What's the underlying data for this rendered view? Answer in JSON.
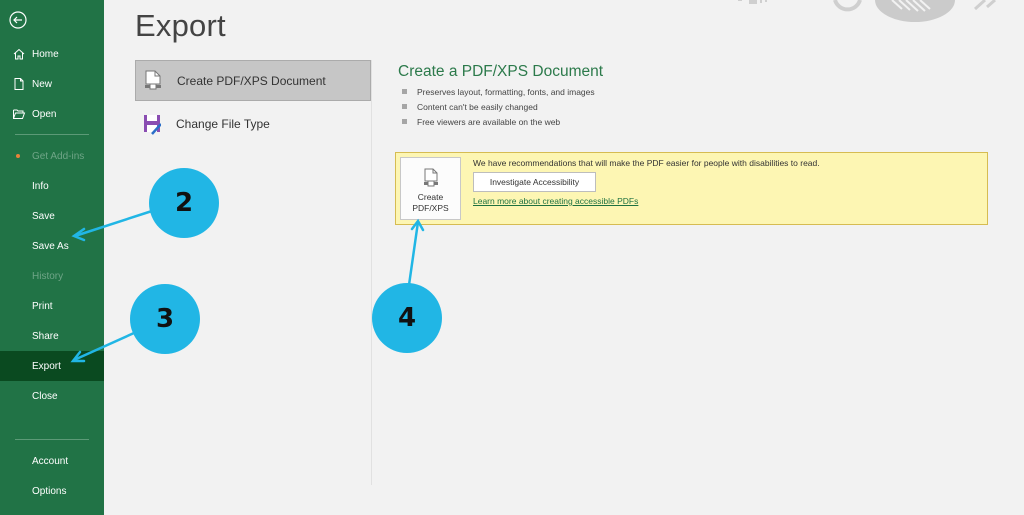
{
  "sidebar": {
    "back_icon": "back-arrow-circle-icon",
    "items": [
      {
        "label": "Home",
        "icon": "home-icon"
      },
      {
        "label": "New",
        "icon": "new-document-icon"
      },
      {
        "label": "Open",
        "icon": "open-folder-icon"
      },
      {
        "label": "Get Add-ins",
        "state": "disabled"
      },
      {
        "label": "Info"
      },
      {
        "label": "Save"
      },
      {
        "label": "Save As"
      },
      {
        "label": "History",
        "state": "disabled"
      },
      {
        "label": "Print"
      },
      {
        "label": "Share"
      },
      {
        "label": "Export",
        "state": "active"
      },
      {
        "label": "Close"
      },
      {
        "label": "Account"
      },
      {
        "label": "Options"
      }
    ]
  },
  "page": {
    "title": "Export"
  },
  "options": [
    {
      "label": "Create PDF/XPS Document",
      "icon": "pdf-document-icon",
      "selected": true
    },
    {
      "label": "Change File Type",
      "icon": "save-file-type-icon",
      "selected": false
    }
  ],
  "detail": {
    "title": "Create a PDF/XPS Document",
    "bullets": [
      "Preserves layout, formatting, fonts, and images",
      "Content can't be easily changed",
      "Free viewers are available on the web"
    ],
    "notice": {
      "create_button_label": "Create PDF/XPS",
      "text": "We have recommendations that will make the PDF easier for people with disabilities to read.",
      "investigate_button": "Investigate Accessibility",
      "learn_link": "Learn more about creating accessible PDFs"
    }
  },
  "annotations": {
    "callout_2": "2",
    "callout_3": "3",
    "callout_4": "4",
    "color": "#21b6e5"
  },
  "colors": {
    "sidebar_bg": "#217346",
    "sidebar_active": "#0a4a20",
    "accent_title": "#2c7a4b",
    "notice_bg": "#fdf6b3"
  }
}
